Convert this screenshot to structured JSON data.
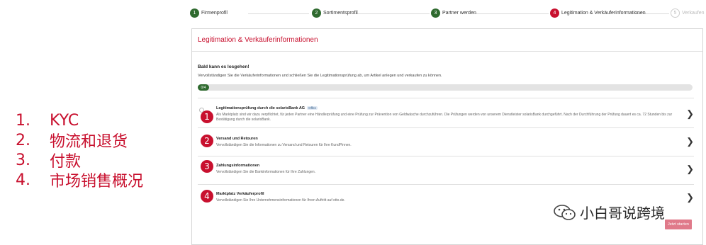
{
  "annotations": {
    "items": [
      {
        "num": "1.",
        "label": "KYC"
      },
      {
        "num": "2.",
        "label": "物流和退货"
      },
      {
        "num": "3.",
        "label": "付款"
      },
      {
        "num": "4.",
        "label": "市场销售概况"
      }
    ],
    "color": "#c8102e"
  },
  "stepper": {
    "steps": [
      {
        "number": "1",
        "label": "Firmenprofil",
        "state": "done"
      },
      {
        "number": "2",
        "label": "Sortimentsprofil",
        "state": "done"
      },
      {
        "number": "3",
        "label": "Partner werden",
        "state": "done"
      },
      {
        "number": "4",
        "label": "Legitimation & Verkäuferinformationen",
        "state": "active"
      },
      {
        "number": "5",
        "label": "Verkaufen",
        "state": "pending"
      }
    ]
  },
  "card": {
    "title": "Legitimation & Verkäuferinformationen",
    "intro_heading": "Bald kann es losgehen!",
    "intro_text": "Vervollständigen Sie die Verkäuferinformationen und schließen Sie die Legitimationsprüfung ab, um Artikel anlegen und verkaufen zu können.",
    "progress_label": "0/4",
    "progress_value": 0,
    "items": [
      {
        "badge": "1",
        "title": "Legitimationsprüfung durch die solarisBank AG",
        "tag": "Offen",
        "description_line1": "Als Marktplatz sind wir dazu verpflichtet, für jeden Partner eine Händlerprüfung und eine Prüfung zur Prävention von Geldwäsche durchzuführen. Die Prüfungen werden von unserem Dienstleister solarisBank durchgeführt. Nach der Durchführung der Prüfung dauert es ca. 72 Stunden bis zur",
        "description_line2": "Bestätigung durch die solarisBank."
      },
      {
        "badge": "2",
        "title": "Versand und Retouren",
        "description_line1": "Vervollständigen Sie die Informationen zu Versand und Retouren für Ihre KundPinnen."
      },
      {
        "badge": "3",
        "title": "Zahlungsinformationen",
        "description_line1": "Vervollständigen Sie die Bankinformationen für Ihre Zahlungen."
      },
      {
        "badge": "4",
        "title": "Marktplatz Verkäuferprofil",
        "description_line1": "Vervollständigen Sie Ihre Unternehmensinformationen für Ihren Auftritt auf otto.de."
      }
    ],
    "chevron": "❯"
  },
  "start_button": "Jetzt starten",
  "watermark": {
    "text": "小白哥说跨境",
    "icon": "wechat-icon"
  },
  "colors": {
    "accent": "#c8102e",
    "done": "#2f6a2f"
  }
}
